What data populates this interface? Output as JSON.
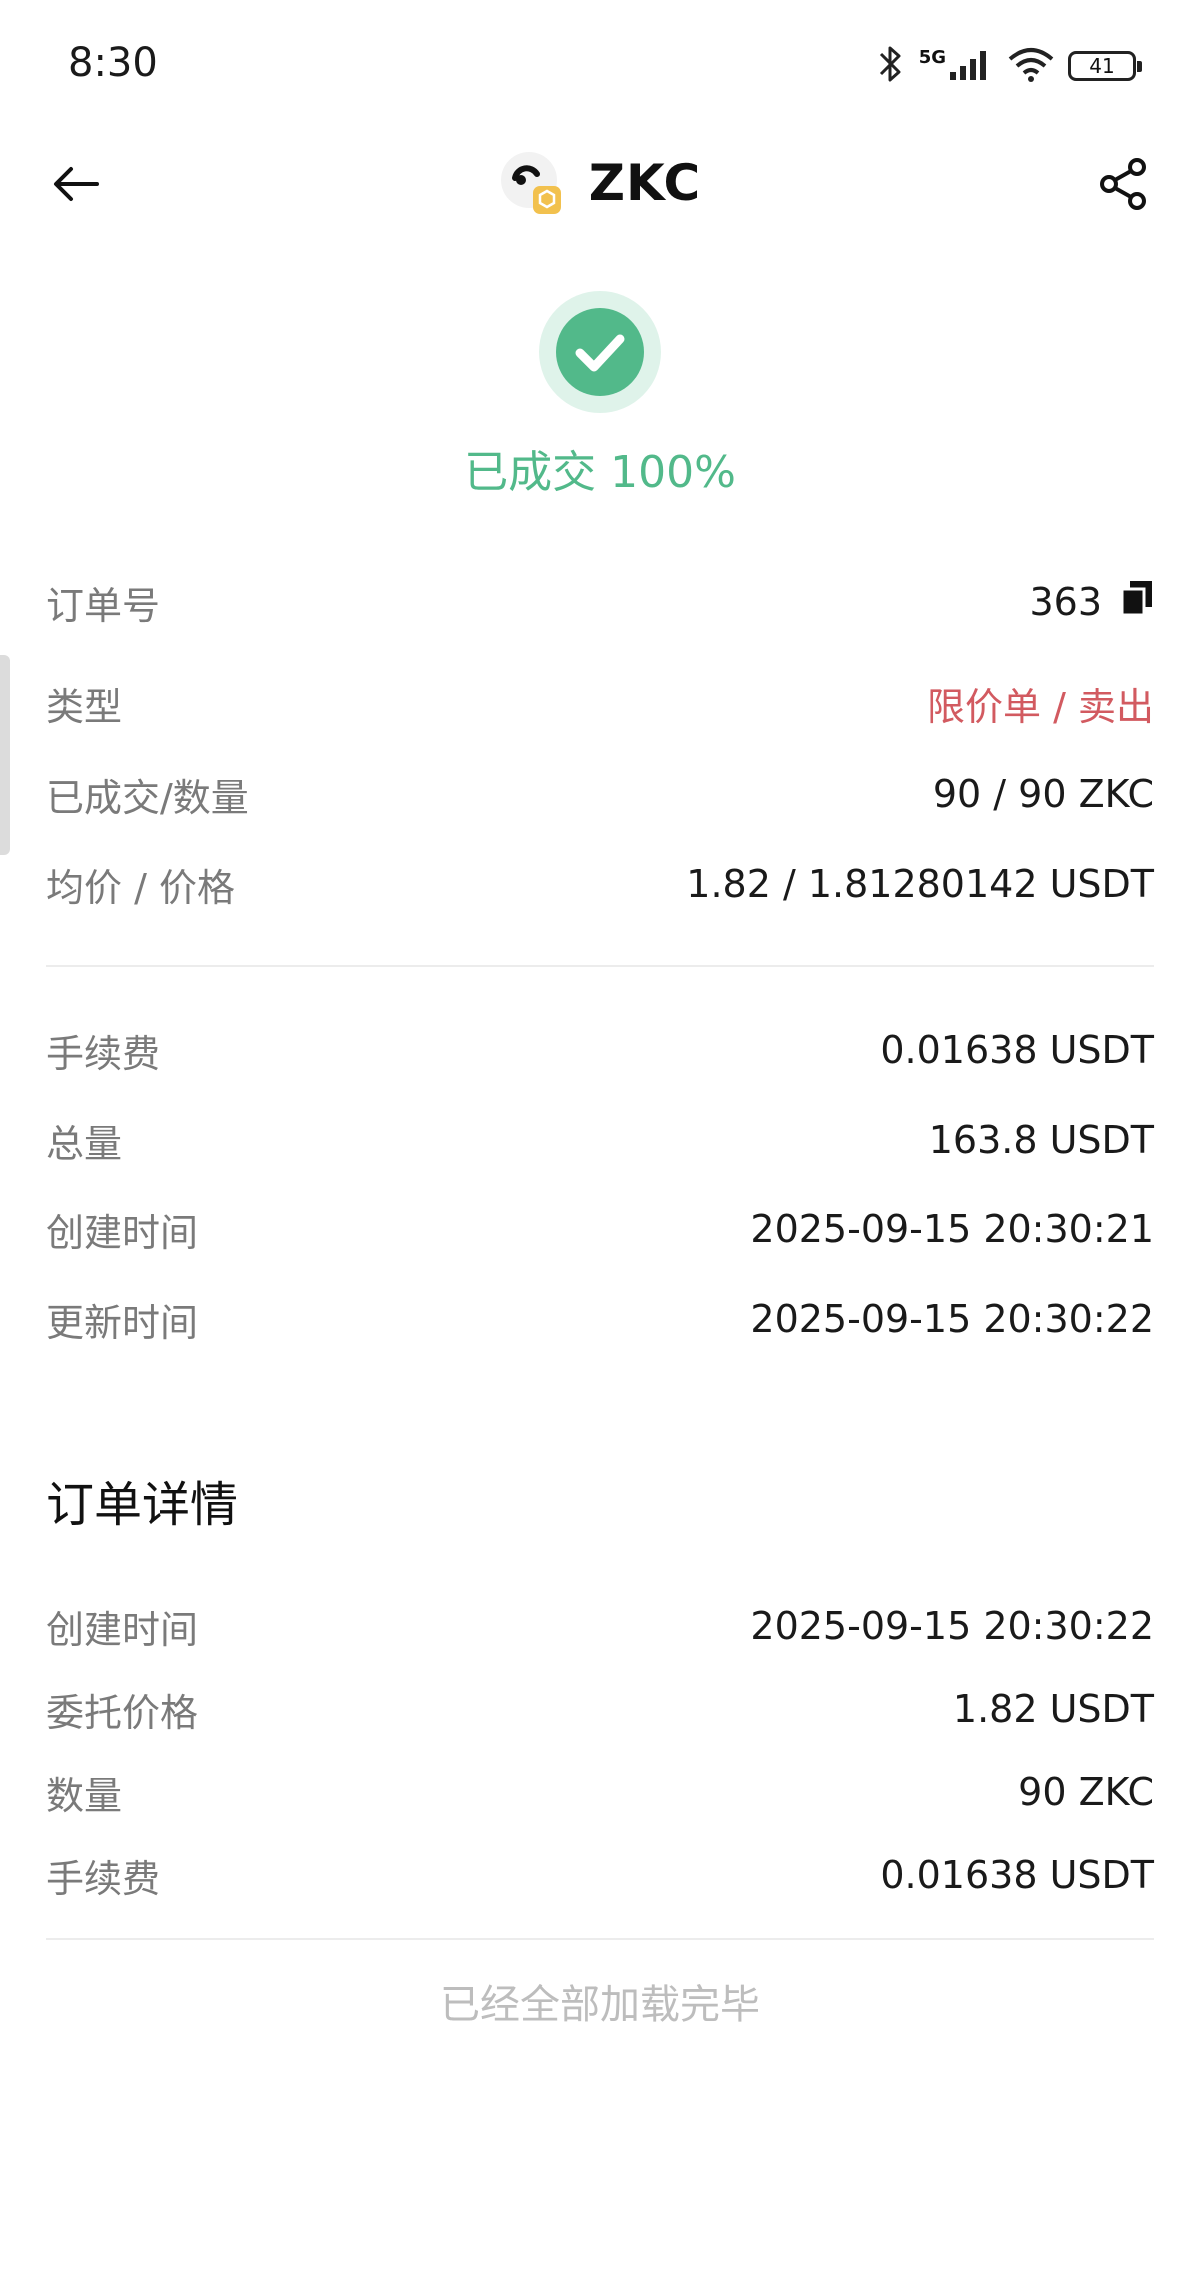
{
  "status_bar": {
    "time": "8:30",
    "network": "5G",
    "battery": "41",
    "icons": [
      "bluetooth-icon",
      "signal-icon",
      "wifi-icon",
      "battery-icon"
    ]
  },
  "header": {
    "title": "ZKC",
    "back_icon": "arrow-left-icon",
    "share_icon": "share-icon"
  },
  "order_status": {
    "text": "已成交 100%",
    "color": "#52b98a",
    "progress_percent": 100,
    "icon": "check-circle-icon"
  },
  "summary": {
    "order_no": {
      "label": "订单号",
      "value": "363",
      "copy_icon": "copy-icon"
    },
    "type": {
      "label": "类型",
      "value": "限价单 / 卖出",
      "color": "#d25a60"
    },
    "filled": {
      "label": "已成交/数量",
      "value": "90 / 90 ZKC"
    },
    "price": {
      "label": "均价 / 价格",
      "value": "1.82 / 1.81280142 USDT"
    },
    "fee": {
      "label": "手续费",
      "value": "0.01638 USDT"
    },
    "total": {
      "label": "总量",
      "value": "163.8 USDT"
    },
    "created": {
      "label": "创建时间",
      "value": "2025-09-15 20:30:21"
    },
    "updated": {
      "label": "更新时间",
      "value": "2025-09-15 20:30:22"
    }
  },
  "details": {
    "title": "订单详情",
    "created": {
      "label": "创建时间",
      "value": "2025-09-15 20:30:22"
    },
    "entrust_price": {
      "label": "委托价格",
      "value": "1.82 USDT"
    },
    "quantity": {
      "label": "数量",
      "value": "90 ZKC"
    },
    "fee": {
      "label": "手续费",
      "value": "0.01638 USDT"
    }
  },
  "footer": {
    "text": "已经全部加载完毕"
  }
}
